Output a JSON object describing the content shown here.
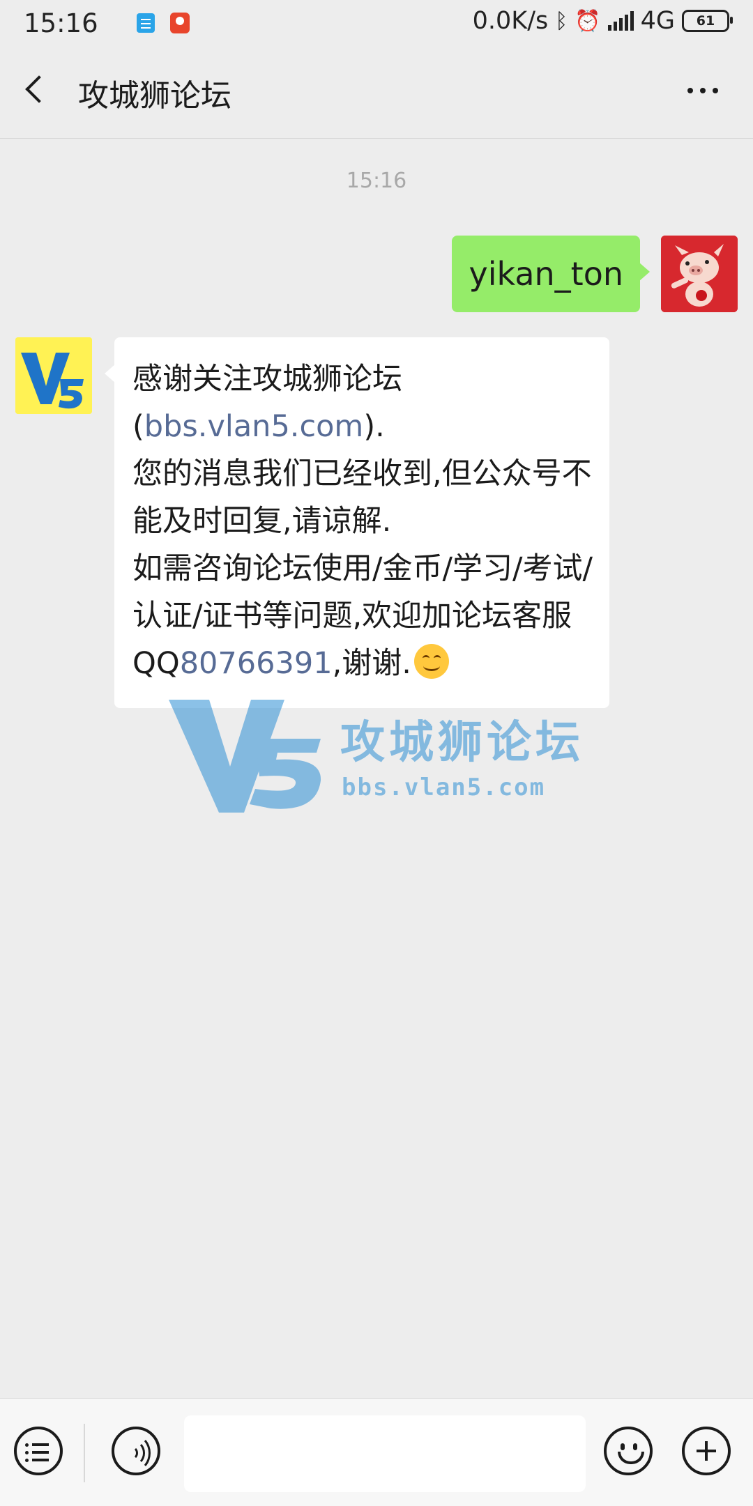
{
  "status_bar": {
    "time": "15:16",
    "net_speed": "0.0K/s",
    "network": "4G",
    "battery": "61"
  },
  "header": {
    "title": "攻城狮论坛"
  },
  "chat": {
    "timestamp": "15:16",
    "sent_message": "yikan_ton",
    "reply": {
      "line1_text": "感谢关注攻城狮论坛(",
      "link_url": "bbs.vlan5.com",
      "line1_end": ").",
      "line2": "您的消息我们已经收到,但公众号不能及时回复,请谅解.",
      "line3_text": "如需咨询论坛使用/金币/学习/考试/认证/证书等问题,欢迎加论坛客服 QQ",
      "qq_number": "80766391",
      "line3_end": ",谢谢."
    }
  },
  "watermark": {
    "logo": "V5",
    "title": "攻城狮论坛",
    "url": "bbs.vlan5.com"
  },
  "icons": {
    "back": "back-icon",
    "more": "more-icon",
    "menu": "menu-icon",
    "voice": "voice-icon",
    "emoji": "emoji-icon",
    "plus": "plus-icon"
  },
  "colors": {
    "sent_bubble": "#95ec69",
    "received_bubble": "#ffffff",
    "link": "#576b95",
    "background": "#ededed"
  }
}
